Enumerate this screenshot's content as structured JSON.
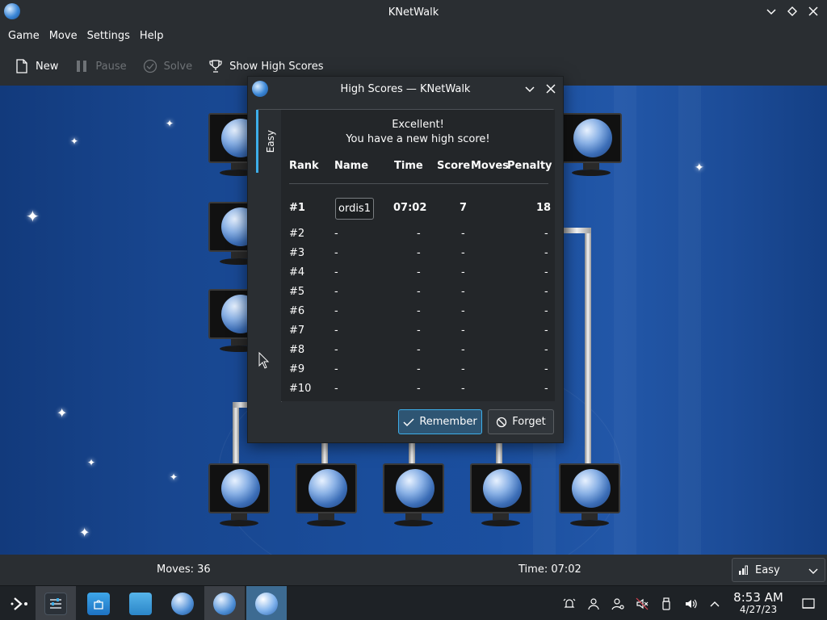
{
  "window": {
    "title": "KNetWalk"
  },
  "menu": [
    "Game",
    "Move",
    "Settings",
    "Help"
  ],
  "toolbar": {
    "new_label": "New",
    "pause_label": "Pause",
    "solve_label": "Solve",
    "highscores_label": "Show High Scores"
  },
  "status": {
    "moves": "Moves: 36",
    "time": "Time: 07:02",
    "difficulty": "Easy"
  },
  "dialog": {
    "title": "High Scores — KNetWalk",
    "tab": "Easy",
    "message_line1": "Excellent!",
    "message_line2": "You have a new high score!",
    "headers": {
      "rank": "Rank",
      "name": "Name",
      "time": "Time",
      "score": "Score",
      "moves": "Moves",
      "penalty": "Penalty"
    },
    "name_input_value": "ordis1",
    "rows": [
      {
        "rank": "#1",
        "name": "",
        "time": "07:02",
        "score": "7",
        "penalty": "18"
      },
      {
        "rank": "#2",
        "name": "-",
        "time": "-",
        "score": "-",
        "penalty": "-"
      },
      {
        "rank": "#3",
        "name": "-",
        "time": "-",
        "score": "-",
        "penalty": "-"
      },
      {
        "rank": "#4",
        "name": "-",
        "time": "-",
        "score": "-",
        "penalty": "-"
      },
      {
        "rank": "#5",
        "name": "-",
        "time": "-",
        "score": "-",
        "penalty": "-"
      },
      {
        "rank": "#6",
        "name": "-",
        "time": "-",
        "score": "-",
        "penalty": "-"
      },
      {
        "rank": "#7",
        "name": "-",
        "time": "-",
        "score": "-",
        "penalty": "-"
      },
      {
        "rank": "#8",
        "name": "-",
        "time": "-",
        "score": "-",
        "penalty": "-"
      },
      {
        "rank": "#9",
        "name": "-",
        "time": "-",
        "score": "-",
        "penalty": "-"
      },
      {
        "rank": "#10",
        "name": "-",
        "time": "-",
        "score": "-",
        "penalty": "-"
      }
    ],
    "remember_label": "Remember",
    "forget_label": "Forget"
  },
  "taskbar": {
    "items": [
      "app-launcher-icon",
      "system-settings-icon",
      "discover-store-icon",
      "dolphin-files-icon",
      "knetwalk-icon",
      "knetwalk-icon",
      "knetwalk-window-icon"
    ]
  },
  "clock": {
    "time": "8:53 AM",
    "date": "4/27/23"
  },
  "colors": {
    "accent": "#3daee9",
    "game_bg": "#1a4d9b",
    "panel": "#2a2e32"
  }
}
